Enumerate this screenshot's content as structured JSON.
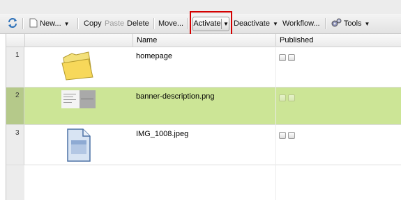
{
  "toolbar": {
    "new_label": "New...",
    "copy_label": "Copy",
    "paste_label": "Paste",
    "delete_label": "Delete",
    "move_label": "Move...",
    "activate_label": "Activate",
    "deactivate_label": "Deactivate",
    "workflow_label": "Workflow...",
    "tools_label": "Tools"
  },
  "grid": {
    "columns": [
      "Name",
      "Published"
    ],
    "rows": [
      {
        "num": "1",
        "name": "homepage",
        "icon": "folder-icon"
      },
      {
        "num": "2",
        "name": "banner-description.png",
        "icon": "image-thumbnail-icon",
        "selected": true
      },
      {
        "num": "3",
        "name": "IMG_1008.jpeg",
        "icon": "document-icon"
      }
    ]
  },
  "colors": {
    "selected_row": "#cce596",
    "highlight_box": "#d40000"
  }
}
